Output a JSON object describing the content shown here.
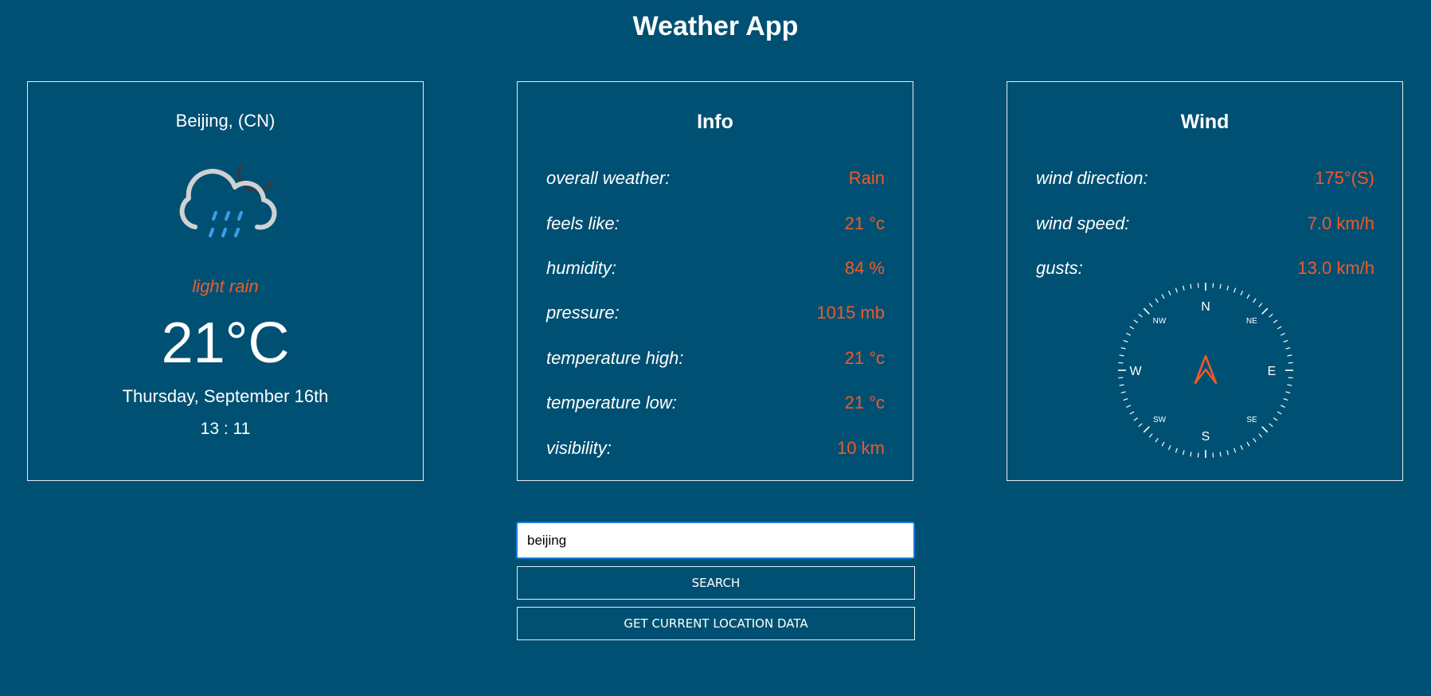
{
  "app": {
    "title": "Weather App"
  },
  "current": {
    "location": "Beijing, (CN)",
    "icon": "cloud-moon-rain-icon",
    "description": "light rain",
    "temperature": "21°C",
    "date": "Thursday, September 16th",
    "time": "13 : 11"
  },
  "info": {
    "heading": "Info",
    "rows": [
      {
        "label": "overall weather:",
        "value": "Rain"
      },
      {
        "label": "feels like:",
        "value": "21 °c"
      },
      {
        "label": "humidity:",
        "value": "84 %"
      },
      {
        "label": "pressure:",
        "value": "1015 mb"
      },
      {
        "label": "temperature high:",
        "value": "21 °c"
      },
      {
        "label": "temperature low:",
        "value": "21 °c"
      },
      {
        "label": "visibility:",
        "value": "10 km"
      }
    ]
  },
  "wind": {
    "heading": "Wind",
    "rows": [
      {
        "label": "wind direction:",
        "value": "175°(S)"
      },
      {
        "label": "wind speed:",
        "value": "7.0 km/h"
      },
      {
        "label": "gusts:",
        "value": "13.0 km/h"
      }
    ],
    "compass": {
      "N": "N",
      "NE": "NE",
      "E": "E",
      "SE": "SE",
      "S": "S",
      "SW": "SW",
      "W": "W",
      "NW": "NW",
      "direction_degrees": 175
    }
  },
  "search": {
    "value": "beijing",
    "button_label": "SEARCH",
    "location_button_label": "GET CURRENT LOCATION DATA"
  },
  "colors": {
    "background": "#005073",
    "accent": "#f05a28",
    "text": "#ffffff",
    "rain": "#3a9fe8"
  }
}
